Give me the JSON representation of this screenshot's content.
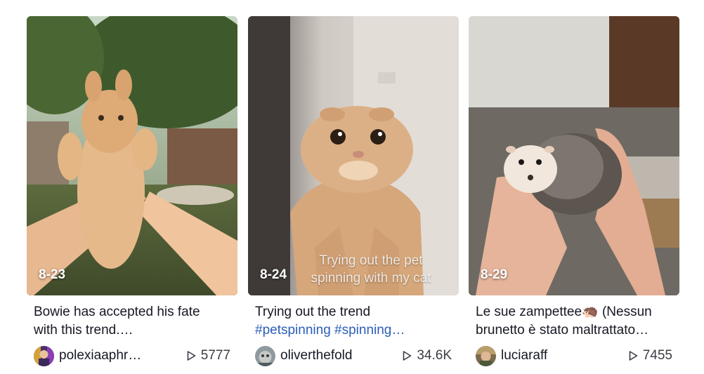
{
  "videos": [
    {
      "date_badge": "8-23",
      "overlay_caption": "",
      "description_line1": "Bowie has accepted his fate",
      "description_line2": "with this trend.…",
      "author": "polexiaaphr…",
      "views": "5777"
    },
    {
      "date_badge": "8-24",
      "overlay_caption_line1": "Trying out the pet",
      "overlay_caption_line2": "spinning with my cat",
      "description_line1": "Trying out the trend",
      "description_line2": "#petspinning #spinning…",
      "author": "oliverthefold",
      "views": "34.6K"
    },
    {
      "date_badge": "8-29",
      "overlay_caption": "",
      "description_line1": "Le sue zampettee🦔 (Nessun",
      "description_line2": "brunetto è stato maltrattato…",
      "author": "luciaraff",
      "views": "7455"
    }
  ],
  "colors": {
    "hashtag": "#2B5DB9",
    "text": "#161823",
    "muted": "#3b3d45"
  },
  "icons": {
    "views": "play-icon"
  }
}
